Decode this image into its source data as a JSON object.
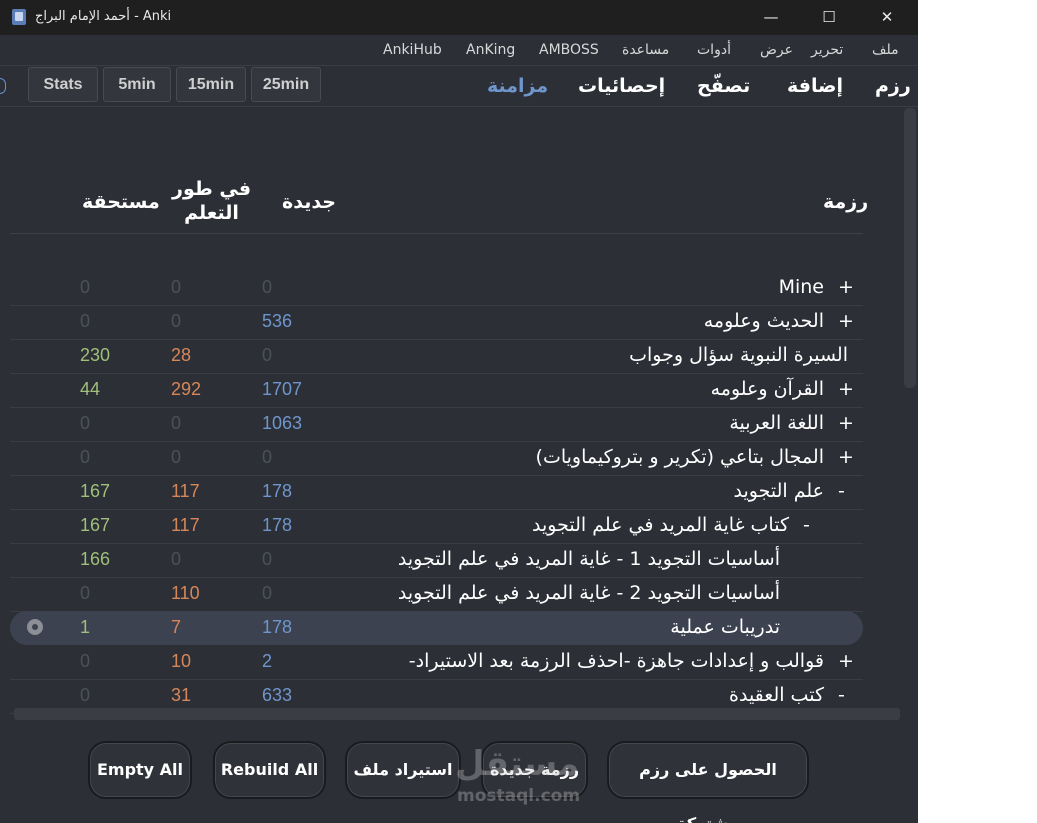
{
  "window": {
    "title": "أحمد الإمام البراج - Anki",
    "minimize": "—",
    "maximize": "☐",
    "close": "✕"
  },
  "menu": [
    "ملف",
    "تحرير",
    "عرض",
    "أدوات",
    "مساعدة",
    "AMBOSS",
    "AnKing",
    "AnkiHub"
  ],
  "toolbar": {
    "nav": {
      "decks": "رزم",
      "add": "إضافة",
      "browse": "تصفّح",
      "stats": "إحصائيات",
      "sync": "مزامنة"
    },
    "addons": [
      "Stats",
      "5min",
      "15min",
      "25min"
    ]
  },
  "headers": {
    "deck": "رزمة",
    "new": "جديدة",
    "learn_line1": "في طور",
    "learn_line2": "التعلم",
    "due": "مستحقة"
  },
  "colors": {
    "new": "#6f96cc",
    "learn": "#d6875a",
    "due": "#9fbf7a",
    "zero": "#4c5058"
  },
  "decks": [
    {
      "name": "Mine",
      "expander": "+",
      "due": "0",
      "learn": "0",
      "new": "0"
    },
    {
      "name": "الحديث وعلومه",
      "expander": "+",
      "due": "0",
      "learn": "0",
      "new": "536"
    },
    {
      "name": "السيرة النبوية سؤال وجواب",
      "expander": "",
      "due": "230",
      "learn": "28",
      "new": "0"
    },
    {
      "name": "القرآن وعلومه",
      "expander": "+",
      "due": "44",
      "learn": "292",
      "new": "1707"
    },
    {
      "name": "اللغة العربية",
      "expander": "+",
      "due": "0",
      "learn": "0",
      "new": "1063"
    },
    {
      "name": "المجال بتاعي (تكرير و بتروكيماويات)",
      "expander": "+",
      "due": "0",
      "learn": "0",
      "new": "0"
    },
    {
      "name": "علم التجويد",
      "expander": "-",
      "due": "167",
      "learn": "117",
      "new": "178"
    },
    {
      "name": "كتاب غاية المريد في علم التجويد",
      "expander": "-",
      "due": "167",
      "learn": "117",
      "new": "178"
    },
    {
      "name": "أساسيات التجويد 1 - غاية المريد في علم التجويد",
      "expander": "",
      "due": "166",
      "learn": "0",
      "new": "0"
    },
    {
      "name": "أساسيات التجويد 2 - غاية المريد في علم التجويد",
      "expander": "",
      "due": "0",
      "learn": "110",
      "new": "0"
    },
    {
      "name": "تدريبات عملية",
      "expander": "",
      "due": "1",
      "learn": "7",
      "new": "178"
    },
    {
      "name": "قوالب و إعدادات جاهزة -احذف الرزمة بعد الاستيراد-",
      "expander": "+",
      "due": "0",
      "learn": "10",
      "new": "2"
    },
    {
      "name": "كتب العقيدة",
      "expander": "-",
      "due": "0",
      "learn": "31",
      "new": "633"
    }
  ],
  "bottom_buttons": {
    "empty_all": "Empty All",
    "rebuild_all": "Rebuild All",
    "import": "استيراد ملف",
    "create": "رزمة جديدة",
    "shared": "الحصول على رزم مشتركة"
  },
  "watermark": {
    "text": "مستقل",
    "url": "mostaql.com"
  }
}
